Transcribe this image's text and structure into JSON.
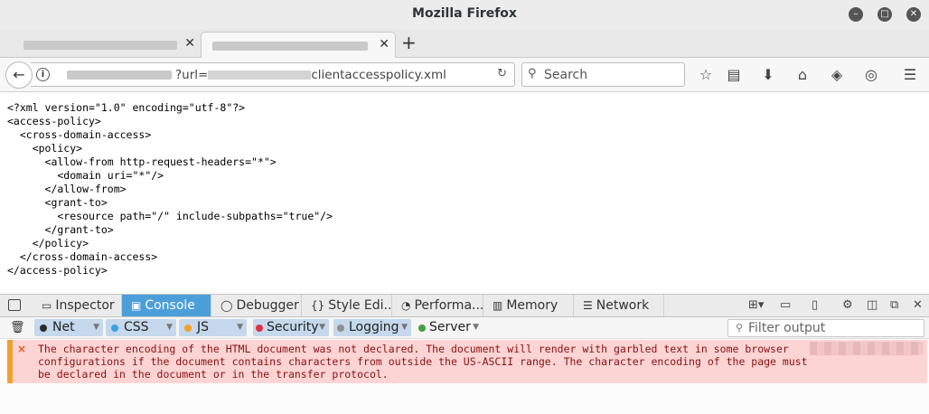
{
  "window": {
    "title": "Mozilla Firefox",
    "minimize_label": "–",
    "maximize_label": "□",
    "close_label": "✕"
  },
  "tabs": {
    "close_label": "✕",
    "new_tab_label": "+"
  },
  "navbar": {
    "back_label": "←",
    "info_label": "i",
    "url_visible": "?url=",
    "url_tail": "clientaccesspolicy.xml",
    "reload_label": "↻",
    "search_placeholder": "Search",
    "search_icon": "🔍",
    "icons": {
      "bookmark": "☆",
      "reading_list": "▤",
      "download": "⬇",
      "home": "⌂",
      "pocket": "◈",
      "sync": "◎",
      "menu": "☰"
    }
  },
  "content": {
    "xml_lines": [
      "<?xml version=\"1.0\" encoding=\"utf-8\"?>",
      "<access-policy>",
      "  <cross-domain-access>",
      "    <policy>",
      "      <allow-from http-request-headers=\"*\">",
      "        <domain uri=\"*\"/>",
      "      </allow-from>",
      "      <grant-to>",
      "        <resource path=\"/\" include-subpaths=\"true\"/>",
      "      </grant-to>",
      "    </policy>",
      "  </cross-domain-access>",
      "</access-policy>"
    ]
  },
  "devtools": {
    "tabs": [
      {
        "label": "Inspector",
        "icon": "▭"
      },
      {
        "label": "Console",
        "icon": "▣",
        "selected": true
      },
      {
        "label": "Debugger",
        "icon": "◯"
      },
      {
        "label": "Style Edi...",
        "icon": "{}"
      },
      {
        "label": "Performa...",
        "icon": "◔"
      },
      {
        "label": "Memory",
        "icon": "▥"
      },
      {
        "label": "Network",
        "icon": "☰"
      }
    ],
    "right_icons": [
      "⊞▾",
      "▭",
      "▯",
      "⚙",
      "◫",
      "⧉",
      "✕"
    ],
    "trash_icon": "🗑",
    "filters": [
      {
        "label": "Net",
        "color": "#2b2b2b",
        "active": true
      },
      {
        "label": "CSS",
        "color": "#3aa0e0",
        "active": true
      },
      {
        "label": "JS",
        "color": "#f0a030",
        "active": true
      },
      {
        "label": "Security",
        "color": "#e03040",
        "active": true
      },
      {
        "label": "Logging",
        "color": "#909090",
        "active": true
      },
      {
        "label": "Server",
        "color": "#40a040",
        "active": false
      }
    ],
    "filter_placeholder": "Filter output",
    "filter_icon": "⚲",
    "message": {
      "icon": "×",
      "text": "The character encoding of the HTML document was not declared. The document will render with garbled text in some browser configurations if the document contains characters from outside the US-ASCII range. The character encoding of the page must be declared in the document or in the transfer protocol."
    }
  }
}
